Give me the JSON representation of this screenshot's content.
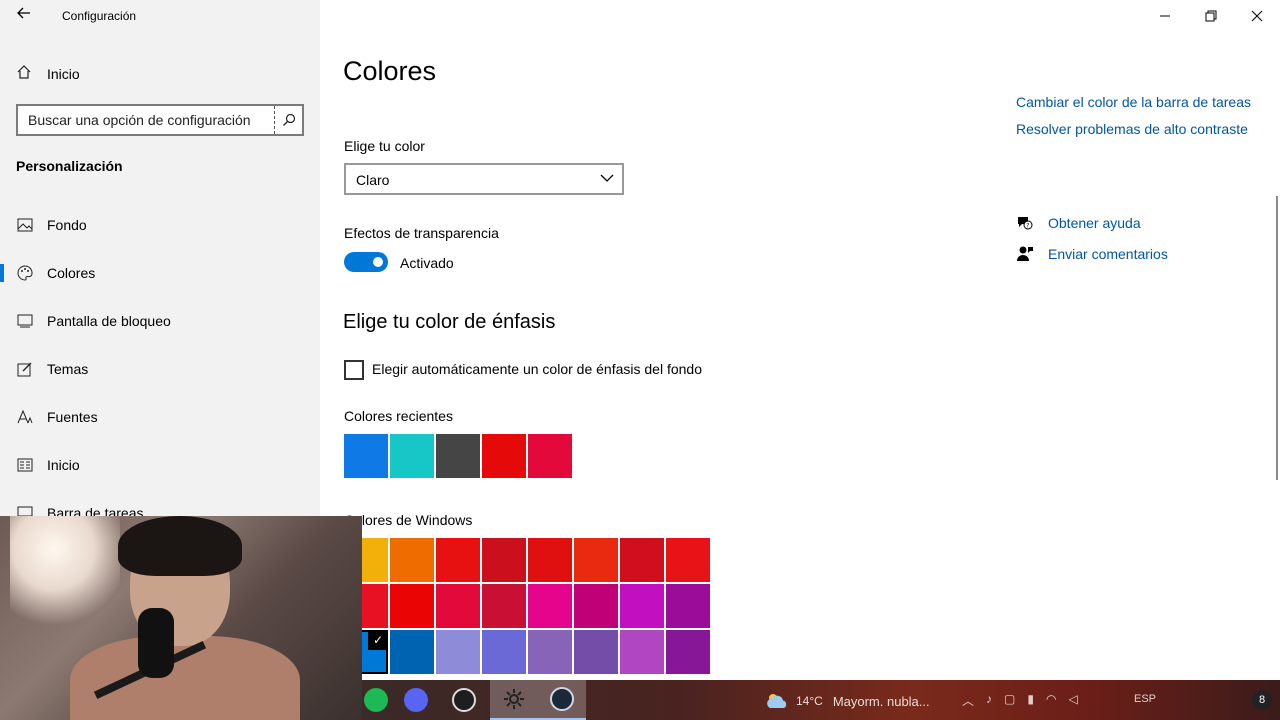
{
  "window": {
    "title": "Configuración",
    "minimize_icon": "minimize-icon",
    "maximize_icon": "restore-icon",
    "close_icon": "close-icon"
  },
  "sidebar": {
    "home_label": "Inicio",
    "search_placeholder": "Buscar una opción de configuración",
    "section_title": "Personalización",
    "items": [
      {
        "label": "Fondo",
        "icon": "picture-icon"
      },
      {
        "label": "Colores",
        "icon": "palette-icon",
        "active": true
      },
      {
        "label": "Pantalla de bloqueo",
        "icon": "lock-screen-icon"
      },
      {
        "label": "Temas",
        "icon": "themes-icon"
      },
      {
        "label": "Fuentes",
        "icon": "fonts-icon"
      },
      {
        "label": "Inicio",
        "icon": "start-icon"
      },
      {
        "label": "Barra de tareas",
        "icon": "taskbar-icon"
      }
    ]
  },
  "main": {
    "title": "Colores",
    "choose_color_label": "Elige tu color",
    "choose_color_value": "Claro",
    "transparency_label": "Efectos de transparencia",
    "transparency_state": "Activado",
    "accent_title": "Elige tu color de énfasis",
    "auto_accent_label": "Elegir automáticamente un color de énfasis del fondo",
    "recent_colors_label": "Colores recientes",
    "recent_colors": [
      "#0f7ae5",
      "#17c7c7",
      "#454545",
      "#e60909",
      "#e3093a"
    ],
    "windows_colors_label": "Colores de Windows",
    "windows_colors": [
      [
        "#f2b10a",
        "#ef6c00",
        "#e81111",
        "#cc0f1c",
        "#e01010",
        "#ea2a10",
        "#d10e1e",
        "#e81316"
      ],
      [
        "#e81123",
        "#ea0404",
        "#e3093a",
        "#c90f33",
        "#e5048c",
        "#bf0077",
        "#c20fc0",
        "#9b0c98"
      ],
      [
        "#0078d7",
        "#0063b1",
        "#8e8cd8",
        "#6b69d6",
        "#8764b8",
        "#744da9",
        "#b146c2",
        "#881798"
      ]
    ]
  },
  "right_panel": {
    "link_taskbar_color": "Cambiar el color de la barra de tareas",
    "link_high_contrast": "Resolver problemas de alto contraste",
    "help_label": "Obtener ayuda",
    "feedback_label": "Enviar comentarios"
  },
  "taskbar": {
    "weather_temp": "14°C",
    "weather_desc": "Mayorm. nubla...",
    "language": "ESP",
    "notification_count": "8"
  }
}
